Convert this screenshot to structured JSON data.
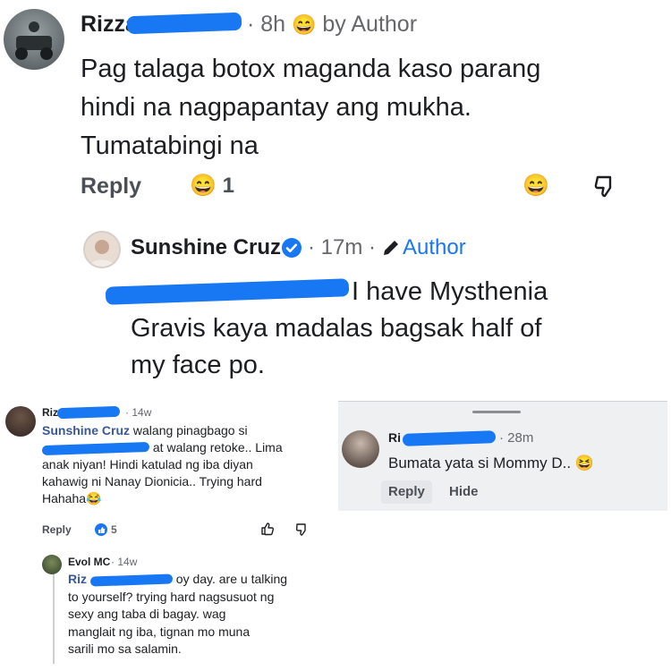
{
  "c1": {
    "name": "Rizza",
    "time": "8h",
    "by_author": "by Author",
    "text_lines": [
      "Pag talaga botox maganda kaso parang",
      "hindi na nagpapantay ang mukha.",
      "Tumatabingi na"
    ],
    "reply": "Reply",
    "reaction_count": "1",
    "reaction_emoji": "😄"
  },
  "r1": {
    "name": "Sunshine Cruz",
    "time": "17m",
    "author": "Author",
    "text_lines": [
      "I have Mysthenia",
      "Gravis kaya madalas bagsak half of",
      "my face po."
    ]
  },
  "c2": {
    "name": "Riz",
    "time": "14w",
    "mention": "Sunshine Cruz",
    "lines": [
      "walang pinagbago si",
      "at walang retoke.. Lima",
      "anak niyan! Hindi katulad ng iba diyan",
      "kahawig ni Nanay Dionicia.. Trying hard",
      "Hahaha😂"
    ],
    "reply": "Reply",
    "likes": "5"
  },
  "c3": {
    "name": "Evol MC",
    "time": "14w",
    "mention": "Riz",
    "lines": [
      "oy day. are u talking",
      "to yourself? trying hard nagsusuot ng",
      "sexy ang taba di bagay.  wag",
      "manglait ng iba, tignan mo muna",
      "sarili mo sa salamin."
    ]
  },
  "c4": {
    "name": "Ri",
    "time": "28m",
    "text": "Bumata yata si Mommy D.. 😆",
    "reply": "Reply",
    "hide": "Hide"
  },
  "colors": {
    "accent": "#1877f2",
    "text": "#1c1e21",
    "meta": "#65676b"
  }
}
